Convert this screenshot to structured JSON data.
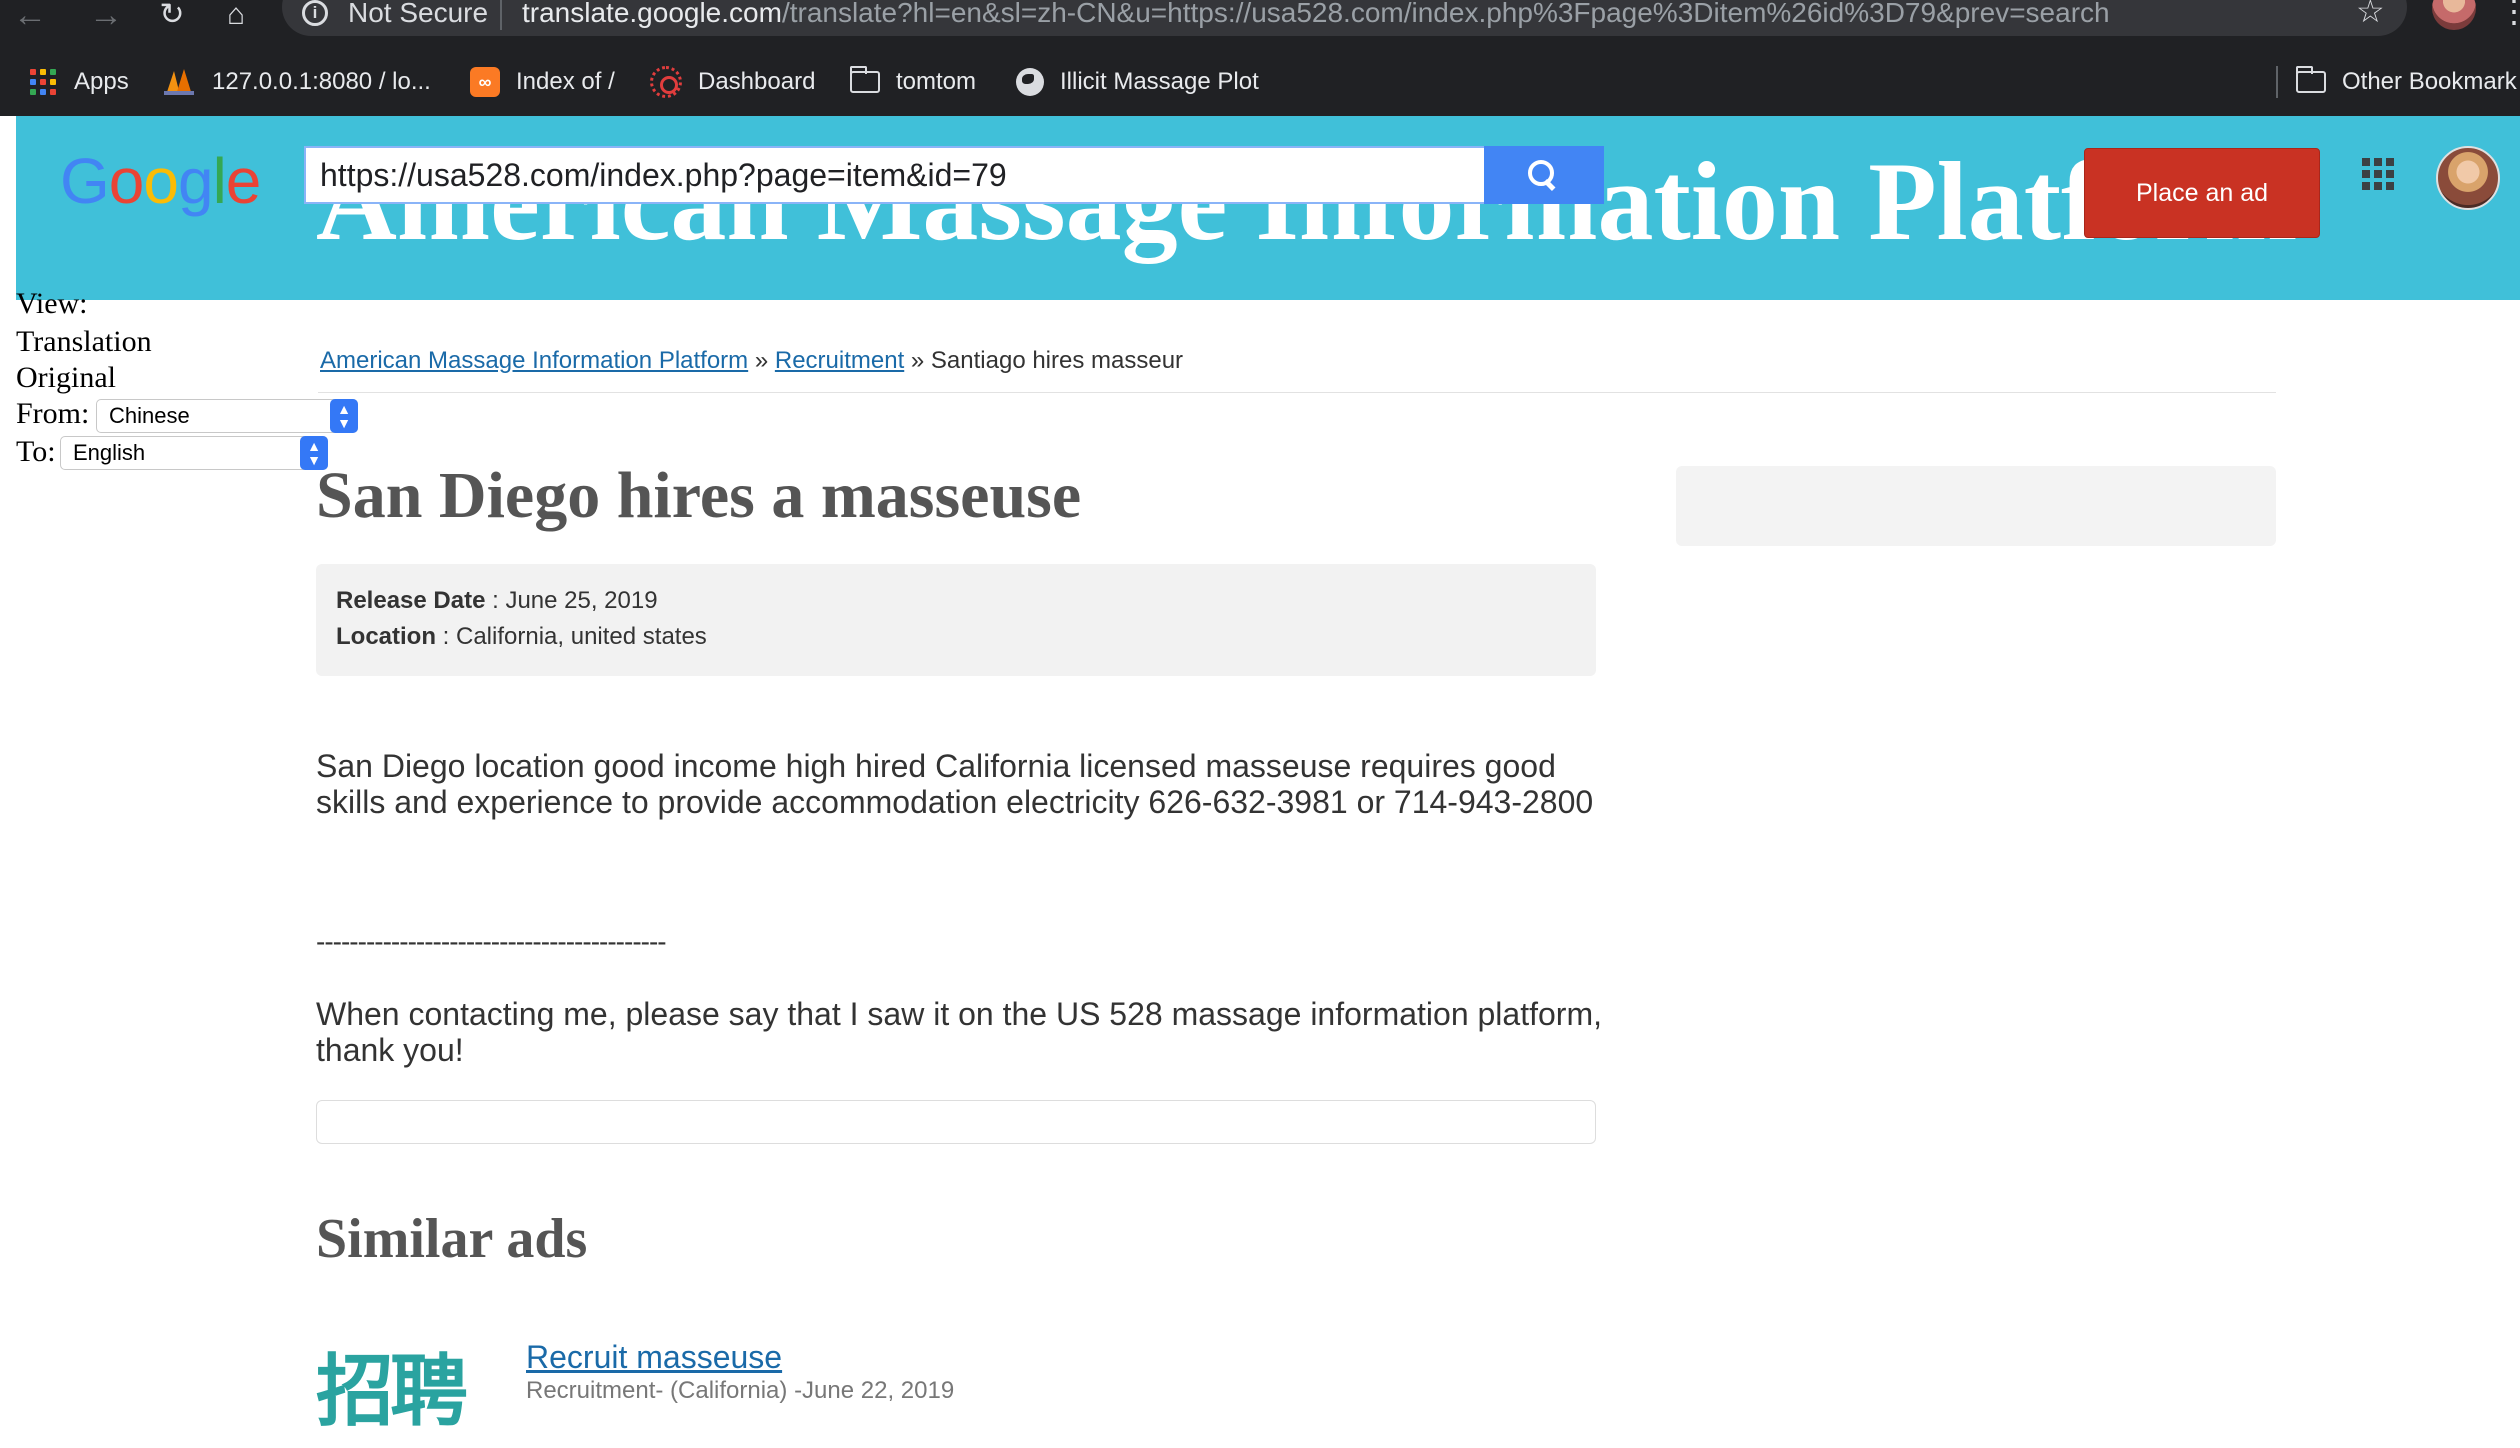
{
  "browser": {
    "not_secure_label": "Not Secure",
    "url_host": "translate.google.com",
    "url_rest": "/translate?hl=en&sl=zh-CN&u=https://usa528.com/index.php%3Fpage%3Ditem%26id%3D79&prev=search",
    "icons": [
      "back-icon",
      "forward-icon",
      "reload-icon",
      "home-icon",
      "info-icon",
      "star-icon",
      "profile-avatar",
      "kebab-menu-icon"
    ]
  },
  "bookmarks": {
    "items": [
      {
        "label": "Apps",
        "icon": "apps-grid-icon"
      },
      {
        "label": "127.0.0.1:8080 / lo...",
        "icon": "phpmyadmin-icon"
      },
      {
        "label": "Index of /",
        "icon": "xampp-icon"
      },
      {
        "label": "Dashboard",
        "icon": "canvas-icon"
      },
      {
        "label": "tomtom",
        "icon": "folder-icon"
      },
      {
        "label": "Illicit Massage Plot",
        "icon": "globe-icon"
      }
    ],
    "other": "Other Bookmark"
  },
  "translate_bar": {
    "site_heading": "American Massage Information Platform",
    "url_value": "https://usa528.com/index.php?page=item&id=79",
    "place_ad": "Place an ad",
    "accent": "#40c0d9",
    "button_color": "#4285f4",
    "ad_color": "#c93223"
  },
  "translate_controls": {
    "view_label": "View:",
    "translation_label": "Translation",
    "original_label": "Original",
    "from_label": "From:",
    "from_value": "Chinese",
    "to_label": "To:",
    "to_value": "English"
  },
  "breadcrumb": {
    "home": "American Massage Information Platform",
    "sep1": " » ",
    "category": "Recruitment",
    "sep2": " » ",
    "current": "Santiago hires masseur"
  },
  "item": {
    "title": "San Diego hires a masseuse",
    "release_label": "Release Date",
    "release_value": " : June 25, 2019",
    "location_label": "Location",
    "location_value": " : California, united states",
    "description": "San Diego location good income high hired California licensed masseuse requires good skills and experience to provide accommodation electricity 626-632-3981 or 714-943-2800",
    "divider": "------------------------------------------",
    "contact_note": "When contacting me, please say that I saw it on the US 528 massage information platform, thank you!"
  },
  "similar": {
    "heading": "Similar ads",
    "thumb_text": "招聘",
    "items": [
      {
        "title": "Recruit masseuse",
        "meta": "Recruitment- (California) -June 22, 2019"
      }
    ]
  }
}
